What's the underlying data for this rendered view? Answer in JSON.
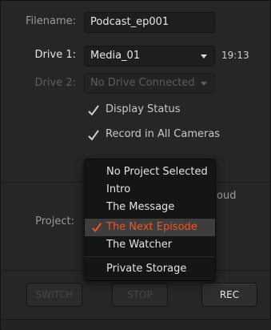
{
  "form": {
    "filename": {
      "label": "Filename:",
      "value": "Podcast_ep001"
    },
    "drive1": {
      "label": "Drive 1:",
      "value": "Media_01",
      "remaining": "19:13"
    },
    "drive2": {
      "label": "Drive 2:",
      "value": "No Drive Connected"
    },
    "checks": [
      {
        "label": "Display Status",
        "checked": true
      },
      {
        "label": "Record in All Cameras",
        "checked": true
      }
    ],
    "partial_text": "oud",
    "project": {
      "label": "Project:",
      "value": "The Next Episode"
    }
  },
  "dropdown": {
    "items": [
      {
        "label": "No Project Selected",
        "selected": false
      },
      {
        "label": "Intro",
        "selected": false
      },
      {
        "label": "The Message",
        "selected": false
      },
      {
        "label": "The Next Episode",
        "selected": true
      },
      {
        "label": "The Watcher",
        "selected": false
      },
      {
        "label": "Private Storage",
        "selected": false
      }
    ]
  },
  "buttons": {
    "switch": "SWITCH",
    "stop": "STOP",
    "rec": "REC"
  },
  "colors": {
    "accent": "#f2541e",
    "panel": "#262626",
    "text": "#e4e4e4"
  },
  "icons": {
    "checkmark": "check-icon",
    "caret": "chevron-down-icon"
  }
}
